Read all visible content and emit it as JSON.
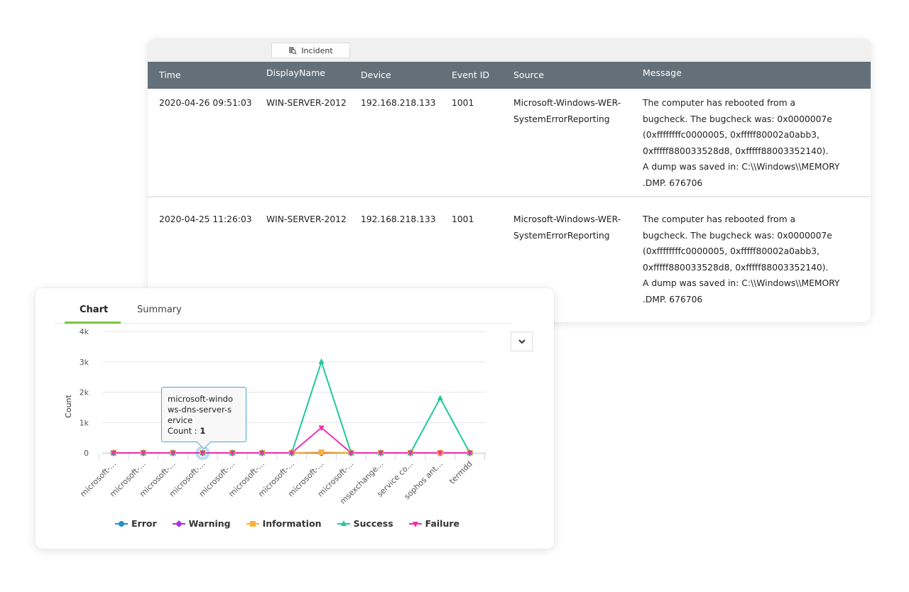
{
  "table": {
    "toolbar": {
      "incident_label": "Incident",
      "incident_icon": "incident-search-icon"
    },
    "columns": [
      "Time",
      "DisplayName",
      "Device",
      "Event ID",
      "Source",
      "Message"
    ],
    "rows": [
      {
        "time": "2020-04-26 09:51:03",
        "display_name": "WIN-SERVER-2012",
        "device": "192.168.218.133",
        "event_id": "1001",
        "source_lines": [
          "Microsoft-Windows-WER-",
          "SystemErrorReporting"
        ],
        "message_lines": [
          "The computer has rebooted from a",
          "bugcheck. The bugcheck was: 0x0000007e",
          "(0xffffffffc0000005, 0xfffff80002a0abb3,",
          "0xfffff880033528d8, 0xfffff88003352140).",
          "A dump was saved in: C:\\\\Windows\\\\MEMORY",
          ".DMP.   676706"
        ]
      },
      {
        "time": "2020-04-25 11:26:03",
        "display_name": "WIN-SERVER-2012",
        "device": "192.168.218.133",
        "event_id": "1001",
        "source_lines": [
          "Microsoft-Windows-WER-",
          "SystemErrorReporting"
        ],
        "message_lines": [
          "The computer has rebooted from a",
          "bugcheck. The bugcheck was: 0x0000007e",
          "(0xffffffffc0000005, 0xfffff80002a0abb3,",
          "0xfffff880033528d8, 0xfffff88003352140).",
          "A dump was saved in: C:\\\\Windows\\\\MEMORY",
          ".DMP.   676706"
        ]
      }
    ]
  },
  "chart_panel": {
    "tabs": [
      {
        "label": "Chart",
        "active": true
      },
      {
        "label": "Summary",
        "active": false
      }
    ],
    "dropdown_icon": "chevron-down-icon",
    "tooltip": {
      "lines": [
        "microsoft-windo",
        "ws-dns-server-s",
        "ervice"
      ],
      "count_label": "Count : ",
      "count_value": "1",
      "category_index": 3
    }
  },
  "chart_data": {
    "type": "line",
    "title": "",
    "xlabel": "",
    "ylabel": "Count",
    "ylim": [
      0,
      4000
    ],
    "yticks": [
      0,
      1000,
      2000,
      3000,
      4000
    ],
    "ytick_labels": [
      "0",
      "1k",
      "2k",
      "3k",
      "4k"
    ],
    "grid": true,
    "legend_position": "bottom",
    "categories": [
      "microsoft-...",
      "microsoft-...",
      "microsoft-...",
      "microsoft-...",
      "microsoft-...",
      "microsoft-...",
      "microsoft-...",
      "microsoft-...",
      "microsoft-...",
      "msexchange...",
      "service co...",
      "sophos ant...",
      "termdd"
    ],
    "series": [
      {
        "name": "Error",
        "color": "#1f8fcf",
        "marker": "circle",
        "values": [
          0,
          0,
          0,
          1,
          0,
          0,
          0,
          0,
          0,
          0,
          0,
          0,
          0
        ]
      },
      {
        "name": "Warning",
        "color": "#a533e0",
        "marker": "diamond",
        "values": [
          0,
          0,
          0,
          0,
          0,
          0,
          0,
          0,
          0,
          0,
          0,
          0,
          0
        ]
      },
      {
        "name": "Information",
        "color": "#f6b23b",
        "marker": "square",
        "values": [
          0,
          0,
          0,
          0,
          0,
          0,
          0,
          20,
          0,
          0,
          0,
          0,
          0
        ]
      },
      {
        "name": "Success",
        "color": "#1ec99a",
        "marker": "triangle",
        "values": [
          0,
          0,
          0,
          0,
          0,
          0,
          0,
          3000,
          0,
          0,
          0,
          1800,
          0
        ]
      },
      {
        "name": "Failure",
        "color": "#ee2fb4",
        "marker": "triangle-down",
        "values": [
          0,
          0,
          0,
          0,
          0,
          0,
          0,
          830,
          0,
          0,
          0,
          0,
          0
        ]
      }
    ]
  }
}
